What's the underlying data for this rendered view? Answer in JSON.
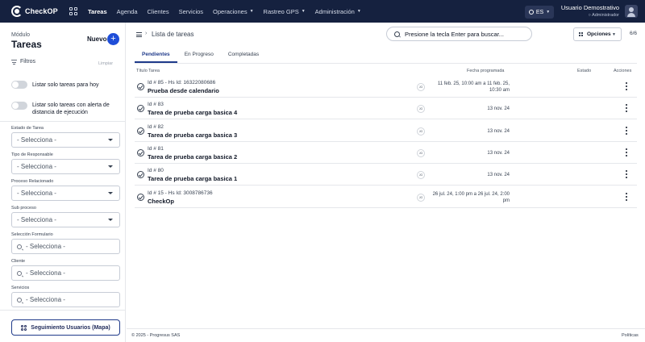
{
  "app": {
    "name": "CheckOP"
  },
  "nav": {
    "items": [
      {
        "label": "Tareas",
        "active": true,
        "has_caret": false
      },
      {
        "label": "Agenda",
        "active": false,
        "has_caret": false
      },
      {
        "label": "Clientes",
        "active": false,
        "has_caret": false
      },
      {
        "label": "Servicios",
        "active": false,
        "has_caret": false
      },
      {
        "label": "Operaciones",
        "active": false,
        "has_caret": true
      },
      {
        "label": "Rastreo GPS",
        "active": false,
        "has_caret": true
      },
      {
        "label": "Administración",
        "active": false,
        "has_caret": true
      }
    ]
  },
  "language": {
    "code": "ES"
  },
  "user": {
    "name": "Usuario Demostrativo",
    "role": "Administrador"
  },
  "sidebar": {
    "module_label": "Módulo",
    "module_title": "Tareas",
    "new_label": "Nuevo",
    "filters_label": "Filtros",
    "clear_label": "Limpiar",
    "toggles": [
      {
        "label": "Listar solo tareas para hoy"
      },
      {
        "label": "Listar solo tareas con alerta de distancia de ejecución"
      }
    ],
    "filters": [
      {
        "label": "Estado de Tarea",
        "value": "- Selecciona -",
        "searchable": false
      },
      {
        "label": "Tipo de Responsable",
        "value": "- Selecciona -",
        "searchable": false
      },
      {
        "label": "Proceso Relacionado",
        "value": "- Selecciona -",
        "searchable": false
      },
      {
        "label": "Sub proceso",
        "value": "- Selecciona -",
        "searchable": false
      },
      {
        "label": "Selección Formulario",
        "value": "- Selecciona -",
        "searchable": true
      },
      {
        "label": "Cliente",
        "value": "- Selecciona -",
        "searchable": true
      },
      {
        "label": "Servicios",
        "value": "- Selecciona -",
        "searchable": true
      }
    ],
    "map_button_label": "Seguimiento Usuarios (Mapa)"
  },
  "main": {
    "breadcrumb": "Lista de tareas",
    "search_placeholder": "Presione la tecla Enter para buscar...",
    "options_label": "Opciones",
    "count": "6/6",
    "tabs": [
      {
        "label": "Pendientes",
        "active": true
      },
      {
        "label": "En Progreso",
        "active": false
      },
      {
        "label": "Completadas",
        "active": false
      }
    ],
    "columns": {
      "title": "Título Tarea",
      "date": "Fecha programada",
      "status": "Estado",
      "actions": "Acciones"
    },
    "rows": [
      {
        "id": "Id # 85 - Hs Id: 16322080686",
        "name": "Prueba desde calendario",
        "badge": "JG",
        "date": "11 feb. 25, 10:00 am a 11 feb. 25, 10:30 am"
      },
      {
        "id": "Id # 83",
        "name": "Tarea de prueba carga basica 4",
        "badge": "JG",
        "date": "13 nov. 24"
      },
      {
        "id": "Id # 82",
        "name": "Tarea de prueba carga basica 3",
        "badge": "JG",
        "date": "13 nov. 24"
      },
      {
        "id": "Id # 81",
        "name": "Tarea de prueba carga basica 2",
        "badge": "JG",
        "date": "13 nov. 24"
      },
      {
        "id": "Id # 80",
        "name": "Tarea de prueba carga basica 1",
        "badge": "JG",
        "date": "13 nov. 24"
      },
      {
        "id": "Id # 15 - Hs Id: 3008786736",
        "name": "CheckOp",
        "badge": "JG",
        "date": "26 jul. 24, 1:00 pm a 26 jul. 24, 2:00 pm"
      }
    ]
  },
  "footer": {
    "copyright": "© 2025 - Progresus SAS",
    "policies": "Políticas"
  },
  "colors": {
    "topbar": "#15213f",
    "accent": "#1f4ed8",
    "tab_active": "#1f3a8a"
  }
}
